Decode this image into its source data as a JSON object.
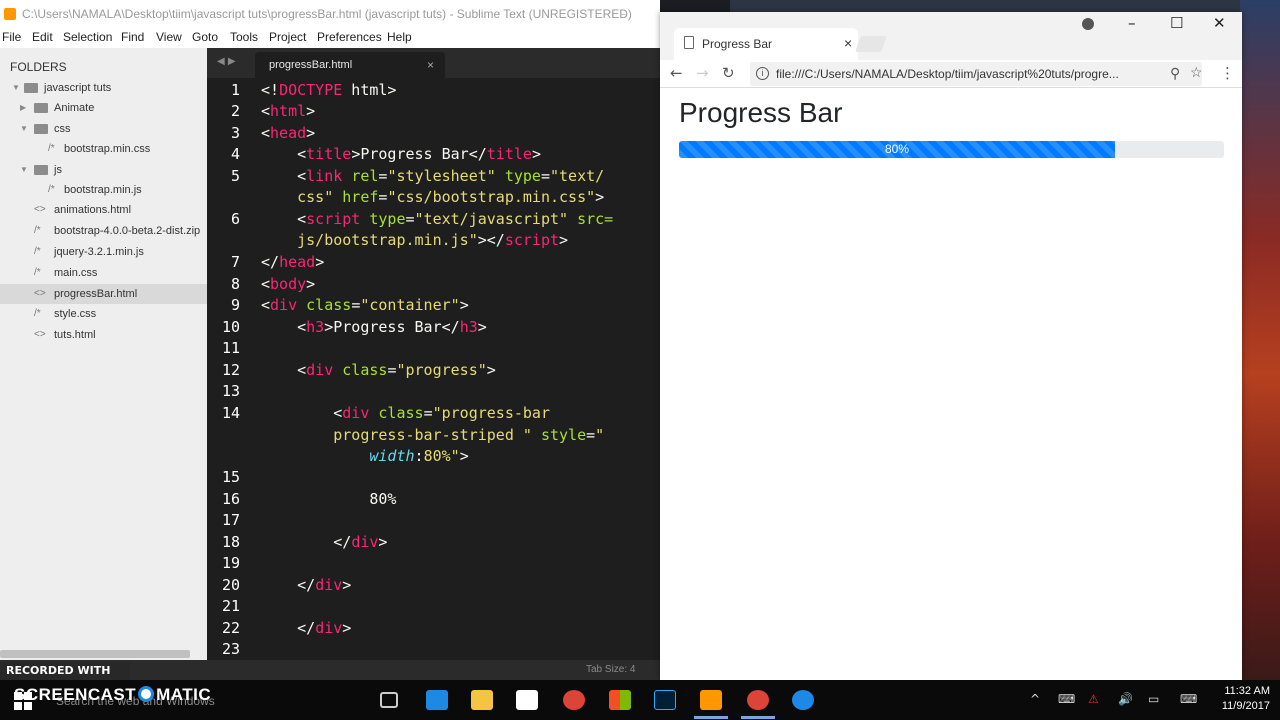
{
  "sublime": {
    "window_title": "C:\\Users\\NAMALA\\Desktop\\tiim\\javascript tuts\\progressBar.html (javascript tuts) - Sublime Text (UNREGISTERED)",
    "menu": [
      "File",
      "Edit",
      "Selection",
      "Find",
      "View",
      "Goto",
      "Tools",
      "Project",
      "Preferences",
      "Help"
    ],
    "sidebar": {
      "header": "FOLDERS",
      "items": [
        {
          "label": "javascript tuts",
          "kind": "folder"
        },
        {
          "label": "Animate",
          "kind": "folder"
        },
        {
          "label": "css",
          "kind": "folder"
        },
        {
          "label": "bootstrap.min.css",
          "kind": "file",
          "icon": "/*"
        },
        {
          "label": "js",
          "kind": "folder"
        },
        {
          "label": "bootstrap.min.js",
          "kind": "file",
          "icon": "/*"
        },
        {
          "label": "animations.html",
          "kind": "file",
          "icon": "<>"
        },
        {
          "label": "bootstrap-4.0.0-beta.2-dist.zip",
          "kind": "file",
          "icon": "/*"
        },
        {
          "label": "jquery-3.2.1.min.js",
          "kind": "file",
          "icon": "/*"
        },
        {
          "label": "main.css",
          "kind": "file",
          "icon": "/*"
        },
        {
          "label": "progressBar.html",
          "kind": "file",
          "icon": "<>",
          "selected": true
        },
        {
          "label": "style.css",
          "kind": "file",
          "icon": "/*"
        },
        {
          "label": "tuts.html",
          "kind": "file",
          "icon": "<>"
        }
      ]
    },
    "tab_label": "progressBar.html",
    "tab_close": "×",
    "line_numbers": [
      "1",
      "2",
      "3",
      "4",
      "5",
      "",
      "6",
      "",
      "7",
      "8",
      "9",
      "10",
      "11",
      "12",
      "13",
      "14",
      "",
      "",
      "15",
      "16",
      "17",
      "18",
      "19",
      "20",
      "21",
      "22",
      "23"
    ],
    "status": {
      "tab_size": "Tab Size: 4"
    }
  },
  "code": {
    "l1": {
      "a": "<!",
      "b": "DOCTYPE",
      "c": " html>"
    },
    "l2": {
      "a": "<",
      "b": "html",
      "c": ">"
    },
    "l3": {
      "a": "<",
      "b": "head",
      "c": ">"
    },
    "l4": {
      "a": "    <",
      "b": "title",
      "c": ">Progress Bar</",
      "d": "title",
      "e": ">"
    },
    "l5": {
      "a": "    <",
      "b": "link",
      "c": " ",
      "d": "rel",
      "e": "=",
      "f": "\"stylesheet\"",
      "g": " ",
      "h": "type",
      "i": "=",
      "j": "\"text/"
    },
    "l5b": {
      "a": "    ",
      "b": "css\"",
      "c": " ",
      "d": "href",
      "e": "=",
      "f": "\"css/bootstrap.min.css\"",
      "g": ">"
    },
    "l6": {
      "a": "    <",
      "b": "script",
      "c": " ",
      "d": "type",
      "e": "=",
      "f": "\"text/javascript\"",
      "g": " ",
      "h": "src="
    },
    "l6b": {
      "a": "    ",
      "b": "js/bootstrap.min.js\"",
      "c": "></",
      "d": "script",
      "e": ">"
    },
    "l7": {
      "a": "</",
      "b": "head",
      "c": ">"
    },
    "l8": {
      "a": "<",
      "b": "body",
      "c": ">"
    },
    "l9": {
      "a": "<",
      "b": "div",
      "c": " ",
      "d": "class",
      "e": "=",
      "f": "\"container\"",
      "g": ">"
    },
    "l10": {
      "a": "    <",
      "b": "h3",
      "c": ">Progress Bar</",
      "d": "h3",
      "e": ">"
    },
    "l12": {
      "a": "    <",
      "b": "div",
      "c": " ",
      "d": "class",
      "e": "=",
      "f": "\"progress\"",
      "g": ">"
    },
    "l14": {
      "a": "        <",
      "b": "div",
      "c": " ",
      "d": "class",
      "e": "=",
      "f": "\"progress-bar"
    },
    "l14b": {
      "a": "        ",
      "b": "progress-bar-striped \"",
      "c": " ",
      "d": "style",
      "e": "=",
      "f": "\""
    },
    "l14c": {
      "a": "            ",
      "b": "width",
      "c": ":",
      "d": "80%\"",
      "e": ">"
    },
    "l16": {
      "a": "            80%"
    },
    "l18": {
      "a": "        </",
      "b": "div",
      "c": ">"
    },
    "l20": {
      "a": "    </",
      "b": "div",
      "c": ">"
    },
    "l22": {
      "a": "    </",
      "b": "div",
      "c": ">"
    }
  },
  "chrome": {
    "tab_title": "Progress Bar",
    "tab_close": "×",
    "url": "file:///C:/Users/NAMALA/Desktop/tiim/javascript%20tuts/progre...",
    "page": {
      "heading": "Progress Bar",
      "progress_value": 80,
      "progress_label": "80%"
    },
    "controls": {
      "min": "–",
      "max": "☐",
      "close": "✕"
    }
  },
  "recorder": {
    "watermark_top": "RECORDED WITH",
    "brand_left": "SCREENCAST",
    "brand_right": "MATIC"
  },
  "taskbar": {
    "search_placeholder": "Search the web and Windows",
    "time": "11:32 AM",
    "date": "11/9/2017"
  },
  "colors": {
    "progress_bar": "#007bff",
    "code_tag": "#f92672",
    "code_attr": "#a6e22e",
    "code_string": "#e6db74",
    "editor_bg": "#1e1e1e"
  }
}
